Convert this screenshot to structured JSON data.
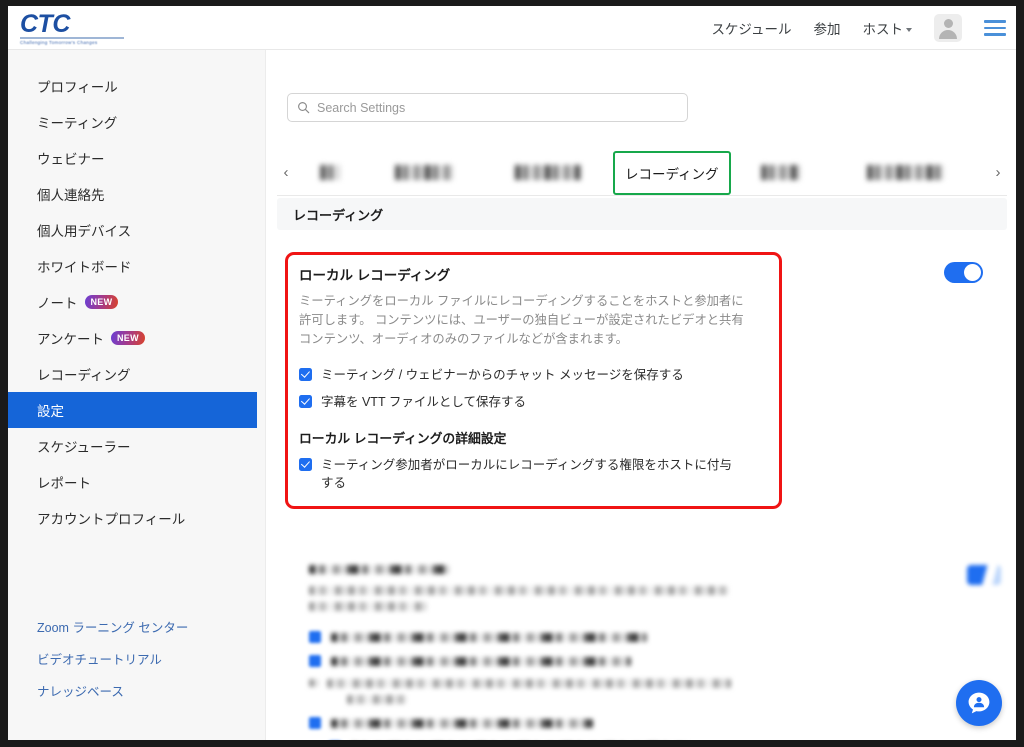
{
  "brand": {
    "logo_text": "CTC",
    "logo_tagline": "Challenging Tomorrow's Changes",
    "accent_blue": "#1f6ef0",
    "annotation_red": "#f01414",
    "annotation_green": "#17a84b",
    "active_item_blue": "#1565d8"
  },
  "topnav": {
    "items": [
      {
        "label": "スケジュール",
        "name": "nav-schedule"
      },
      {
        "label": "参加",
        "name": "nav-join"
      },
      {
        "label": "ホスト",
        "name": "nav-host",
        "has_caret": true
      }
    ],
    "avatar_name": "user-avatar",
    "menu_name": "hamburger-menu"
  },
  "sidebar": {
    "items": [
      {
        "label": "プロフィール",
        "active": false,
        "badge": ""
      },
      {
        "label": "ミーティング",
        "active": false,
        "badge": ""
      },
      {
        "label": "ウェビナー",
        "active": false,
        "badge": ""
      },
      {
        "label": "個人連絡先",
        "active": false,
        "badge": ""
      },
      {
        "label": "個人用デバイス",
        "active": false,
        "badge": ""
      },
      {
        "label": "ホワイトボード",
        "active": false,
        "badge": ""
      },
      {
        "label": "ノート",
        "active": false,
        "badge": "NEW"
      },
      {
        "label": "アンケート",
        "active": false,
        "badge": "NEW"
      },
      {
        "label": "レコーディング",
        "active": false,
        "badge": ""
      },
      {
        "label": "設定",
        "active": true,
        "badge": ""
      },
      {
        "label": "スケジューラー",
        "active": false,
        "badge": ""
      },
      {
        "label": "レポート",
        "active": false,
        "badge": ""
      },
      {
        "label": "アカウントプロフィール",
        "active": false,
        "badge": ""
      }
    ],
    "links": [
      {
        "label": "Zoom ラーニング センター"
      },
      {
        "label": "ビデオチュートリアル"
      },
      {
        "label": "ナレッジベース"
      }
    ]
  },
  "search": {
    "placeholder": "Search Settings",
    "value": "",
    "icon": "search-icon"
  },
  "tabs": {
    "prev_icon": "chevron-left-icon",
    "next_icon": "chevron-right-icon",
    "items": [
      {
        "label": "██",
        "redacted": true,
        "selected": false,
        "width": 56
      },
      {
        "label": "██████",
        "redacted": true,
        "selected": false,
        "width": 104
      },
      {
        "label": "███████",
        "redacted": true,
        "selected": false,
        "width": 118
      },
      {
        "label": "レコーディング",
        "redacted": false,
        "selected": true,
        "width": 0
      },
      {
        "label": "████",
        "redacted": true,
        "selected": false,
        "width": 82
      },
      {
        "label": "████████",
        "redacted": true,
        "selected": false,
        "width": 130
      }
    ]
  },
  "section": {
    "header": "レコーディング"
  },
  "local_recording": {
    "title": "ローカル レコーディング",
    "toggle_on": true,
    "description": "ミーティングをローカル ファイルにレコーディングすることをホストと参加者に許可します。 コンテンツには、ユーザーの独自ビューが設定されたビデオと共有コンテンツ、オーディオのみのファイルなどが含まれます。",
    "checkboxes": [
      {
        "label": "ミーティング / ウェビナーからのチャット メッセージを保存する",
        "checked": true
      },
      {
        "label": "字幕を VTT ファイルとして保存する",
        "checked": true
      }
    ],
    "advanced_heading": "ローカル レコーディングの詳細設定",
    "advanced_checkboxes": [
      {
        "label": "ミーティング参加者がローカルにレコーディングする権限をホストに付与する",
        "checked": true
      }
    ]
  },
  "blurred_section": {
    "note": "redacted",
    "title_blurred": true,
    "description_lines": 2,
    "checkbox_rows": 5
  },
  "help": {
    "name": "help-chat-button",
    "icon": "person-chat-icon"
  }
}
